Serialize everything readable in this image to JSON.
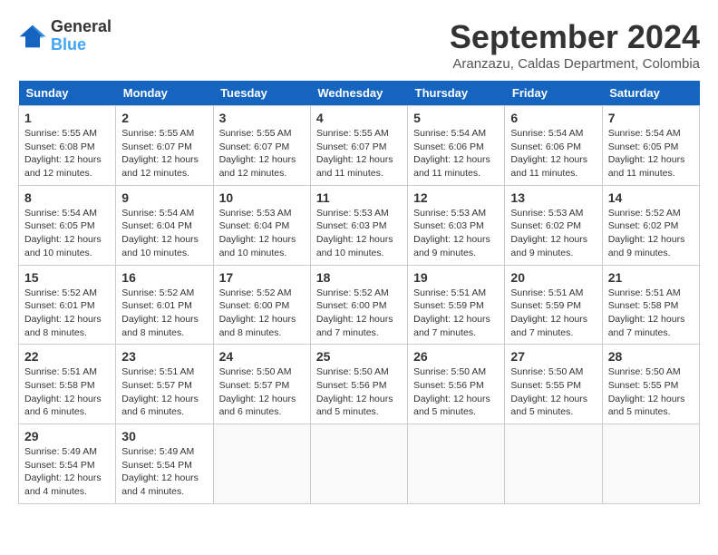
{
  "logo": {
    "line1": "General",
    "line2": "Blue"
  },
  "title": "September 2024",
  "location": "Aranzazu, Caldas Department, Colombia",
  "days_of_week": [
    "Sunday",
    "Monday",
    "Tuesday",
    "Wednesday",
    "Thursday",
    "Friday",
    "Saturday"
  ],
  "weeks": [
    [
      {
        "day": "1",
        "rise": "Sunrise: 5:55 AM",
        "set": "Sunset: 6:08 PM",
        "daylight": "Daylight: 12 hours and 12 minutes."
      },
      {
        "day": "2",
        "rise": "Sunrise: 5:55 AM",
        "set": "Sunset: 6:07 PM",
        "daylight": "Daylight: 12 hours and 12 minutes."
      },
      {
        "day": "3",
        "rise": "Sunrise: 5:55 AM",
        "set": "Sunset: 6:07 PM",
        "daylight": "Daylight: 12 hours and 12 minutes."
      },
      {
        "day": "4",
        "rise": "Sunrise: 5:55 AM",
        "set": "Sunset: 6:07 PM",
        "daylight": "Daylight: 12 hours and 11 minutes."
      },
      {
        "day": "5",
        "rise": "Sunrise: 5:54 AM",
        "set": "Sunset: 6:06 PM",
        "daylight": "Daylight: 12 hours and 11 minutes."
      },
      {
        "day": "6",
        "rise": "Sunrise: 5:54 AM",
        "set": "Sunset: 6:06 PM",
        "daylight": "Daylight: 12 hours and 11 minutes."
      },
      {
        "day": "7",
        "rise": "Sunrise: 5:54 AM",
        "set": "Sunset: 6:05 PM",
        "daylight": "Daylight: 12 hours and 11 minutes."
      }
    ],
    [
      {
        "day": "8",
        "rise": "Sunrise: 5:54 AM",
        "set": "Sunset: 6:05 PM",
        "daylight": "Daylight: 12 hours and 10 minutes."
      },
      {
        "day": "9",
        "rise": "Sunrise: 5:54 AM",
        "set": "Sunset: 6:04 PM",
        "daylight": "Daylight: 12 hours and 10 minutes."
      },
      {
        "day": "10",
        "rise": "Sunrise: 5:53 AM",
        "set": "Sunset: 6:04 PM",
        "daylight": "Daylight: 12 hours and 10 minutes."
      },
      {
        "day": "11",
        "rise": "Sunrise: 5:53 AM",
        "set": "Sunset: 6:03 PM",
        "daylight": "Daylight: 12 hours and 10 minutes."
      },
      {
        "day": "12",
        "rise": "Sunrise: 5:53 AM",
        "set": "Sunset: 6:03 PM",
        "daylight": "Daylight: 12 hours and 9 minutes."
      },
      {
        "day": "13",
        "rise": "Sunrise: 5:53 AM",
        "set": "Sunset: 6:02 PM",
        "daylight": "Daylight: 12 hours and 9 minutes."
      },
      {
        "day": "14",
        "rise": "Sunrise: 5:52 AM",
        "set": "Sunset: 6:02 PM",
        "daylight": "Daylight: 12 hours and 9 minutes."
      }
    ],
    [
      {
        "day": "15",
        "rise": "Sunrise: 5:52 AM",
        "set": "Sunset: 6:01 PM",
        "daylight": "Daylight: 12 hours and 8 minutes."
      },
      {
        "day": "16",
        "rise": "Sunrise: 5:52 AM",
        "set": "Sunset: 6:01 PM",
        "daylight": "Daylight: 12 hours and 8 minutes."
      },
      {
        "day": "17",
        "rise": "Sunrise: 5:52 AM",
        "set": "Sunset: 6:00 PM",
        "daylight": "Daylight: 12 hours and 8 minutes."
      },
      {
        "day": "18",
        "rise": "Sunrise: 5:52 AM",
        "set": "Sunset: 6:00 PM",
        "daylight": "Daylight: 12 hours and 7 minutes."
      },
      {
        "day": "19",
        "rise": "Sunrise: 5:51 AM",
        "set": "Sunset: 5:59 PM",
        "daylight": "Daylight: 12 hours and 7 minutes."
      },
      {
        "day": "20",
        "rise": "Sunrise: 5:51 AM",
        "set": "Sunset: 5:59 PM",
        "daylight": "Daylight: 12 hours and 7 minutes."
      },
      {
        "day": "21",
        "rise": "Sunrise: 5:51 AM",
        "set": "Sunset: 5:58 PM",
        "daylight": "Daylight: 12 hours and 7 minutes."
      }
    ],
    [
      {
        "day": "22",
        "rise": "Sunrise: 5:51 AM",
        "set": "Sunset: 5:58 PM",
        "daylight": "Daylight: 12 hours and 6 minutes."
      },
      {
        "day": "23",
        "rise": "Sunrise: 5:51 AM",
        "set": "Sunset: 5:57 PM",
        "daylight": "Daylight: 12 hours and 6 minutes."
      },
      {
        "day": "24",
        "rise": "Sunrise: 5:50 AM",
        "set": "Sunset: 5:57 PM",
        "daylight": "Daylight: 12 hours and 6 minutes."
      },
      {
        "day": "25",
        "rise": "Sunrise: 5:50 AM",
        "set": "Sunset: 5:56 PM",
        "daylight": "Daylight: 12 hours and 5 minutes."
      },
      {
        "day": "26",
        "rise": "Sunrise: 5:50 AM",
        "set": "Sunset: 5:56 PM",
        "daylight": "Daylight: 12 hours and 5 minutes."
      },
      {
        "day": "27",
        "rise": "Sunrise: 5:50 AM",
        "set": "Sunset: 5:55 PM",
        "daylight": "Daylight: 12 hours and 5 minutes."
      },
      {
        "day": "28",
        "rise": "Sunrise: 5:50 AM",
        "set": "Sunset: 5:55 PM",
        "daylight": "Daylight: 12 hours and 5 minutes."
      }
    ],
    [
      {
        "day": "29",
        "rise": "Sunrise: 5:49 AM",
        "set": "Sunset: 5:54 PM",
        "daylight": "Daylight: 12 hours and 4 minutes."
      },
      {
        "day": "30",
        "rise": "Sunrise: 5:49 AM",
        "set": "Sunset: 5:54 PM",
        "daylight": "Daylight: 12 hours and 4 minutes."
      },
      {
        "day": "",
        "rise": "",
        "set": "",
        "daylight": ""
      },
      {
        "day": "",
        "rise": "",
        "set": "",
        "daylight": ""
      },
      {
        "day": "",
        "rise": "",
        "set": "",
        "daylight": ""
      },
      {
        "day": "",
        "rise": "",
        "set": "",
        "daylight": ""
      },
      {
        "day": "",
        "rise": "",
        "set": "",
        "daylight": ""
      }
    ]
  ]
}
